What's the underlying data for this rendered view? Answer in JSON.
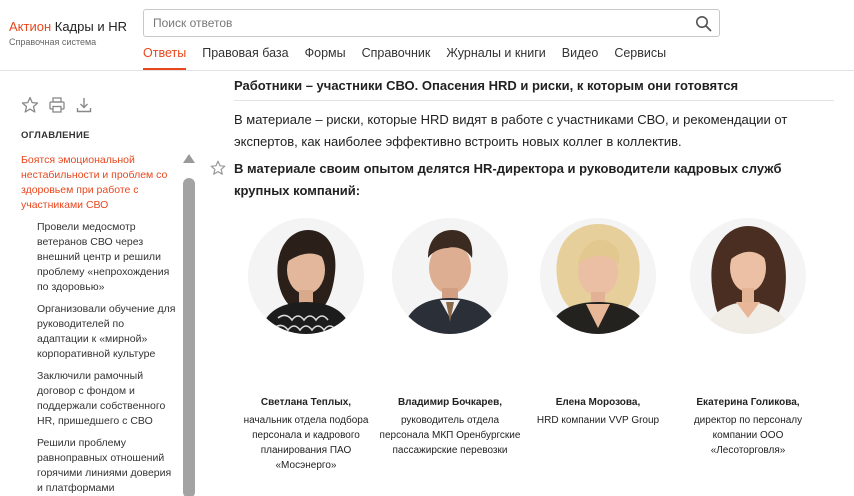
{
  "header": {
    "brand": "Актион",
    "title_rest": " Кадры и HR",
    "subtitle": "Справочная система",
    "search_placeholder": "Поиск ответов"
  },
  "nav": {
    "tabs": [
      {
        "label": "Ответы",
        "active": true
      },
      {
        "label": "Правовая база"
      },
      {
        "label": "Формы"
      },
      {
        "label": "Справочник"
      },
      {
        "label": "Журналы и книги"
      },
      {
        "label": "Видео"
      },
      {
        "label": "Сервисы"
      }
    ]
  },
  "sidebar": {
    "toc_heading": "ОГЛАВЛЕНИЕ",
    "items": [
      {
        "label": "Боятся эмоциональной нестабильности и проблем со здоровьем при работе с участниками СВО",
        "active": true
      },
      {
        "label": "Провели медосмотр ветеранов СВО через внешний центр и решили проблему «непрохождения по здоровью»"
      },
      {
        "label": "Организовали обучение для руководителей по адаптации к «мирной» корпоративной культуре"
      },
      {
        "label": "Заключили рамочный договор с фондом и поддержали собственного HR, пришедшего с СВО"
      },
      {
        "label": "Решили проблему равноправных отношений горячими линиями доверия и платформами"
      }
    ]
  },
  "article": {
    "title": "Работники – участники СВО. Опасения HRD и риски, к которым они готовятся",
    "intro": "В материале – риски, которые HRD видят в работе с участниками СВО, и рекомендации от экспертов, как наиболее эффективно встроить новых коллег в коллектив.",
    "lead": "В материале своим опытом делятся HR-директора и руководители кадровых служб крупных компаний:"
  },
  "experts": [
    {
      "name": "Светлана Теплых,",
      "role": "начальник отдела подбора персонала и кадрового планирования ПАО «Мосэнерго»"
    },
    {
      "name": "Владимир Бочкарев,",
      "role": "руководитель отдела персонала МКП Оренбургские пассажирские перевозки"
    },
    {
      "name": "Елена Морозова,",
      "role": "HRD компании VVP Group"
    },
    {
      "name": "Екатерина Голикова,",
      "role": "директор по персоналу компании ООО «Лесоторговля»"
    }
  ],
  "colors": {
    "accent": "#e8471e",
    "text": "#222222",
    "muted": "#666666"
  }
}
